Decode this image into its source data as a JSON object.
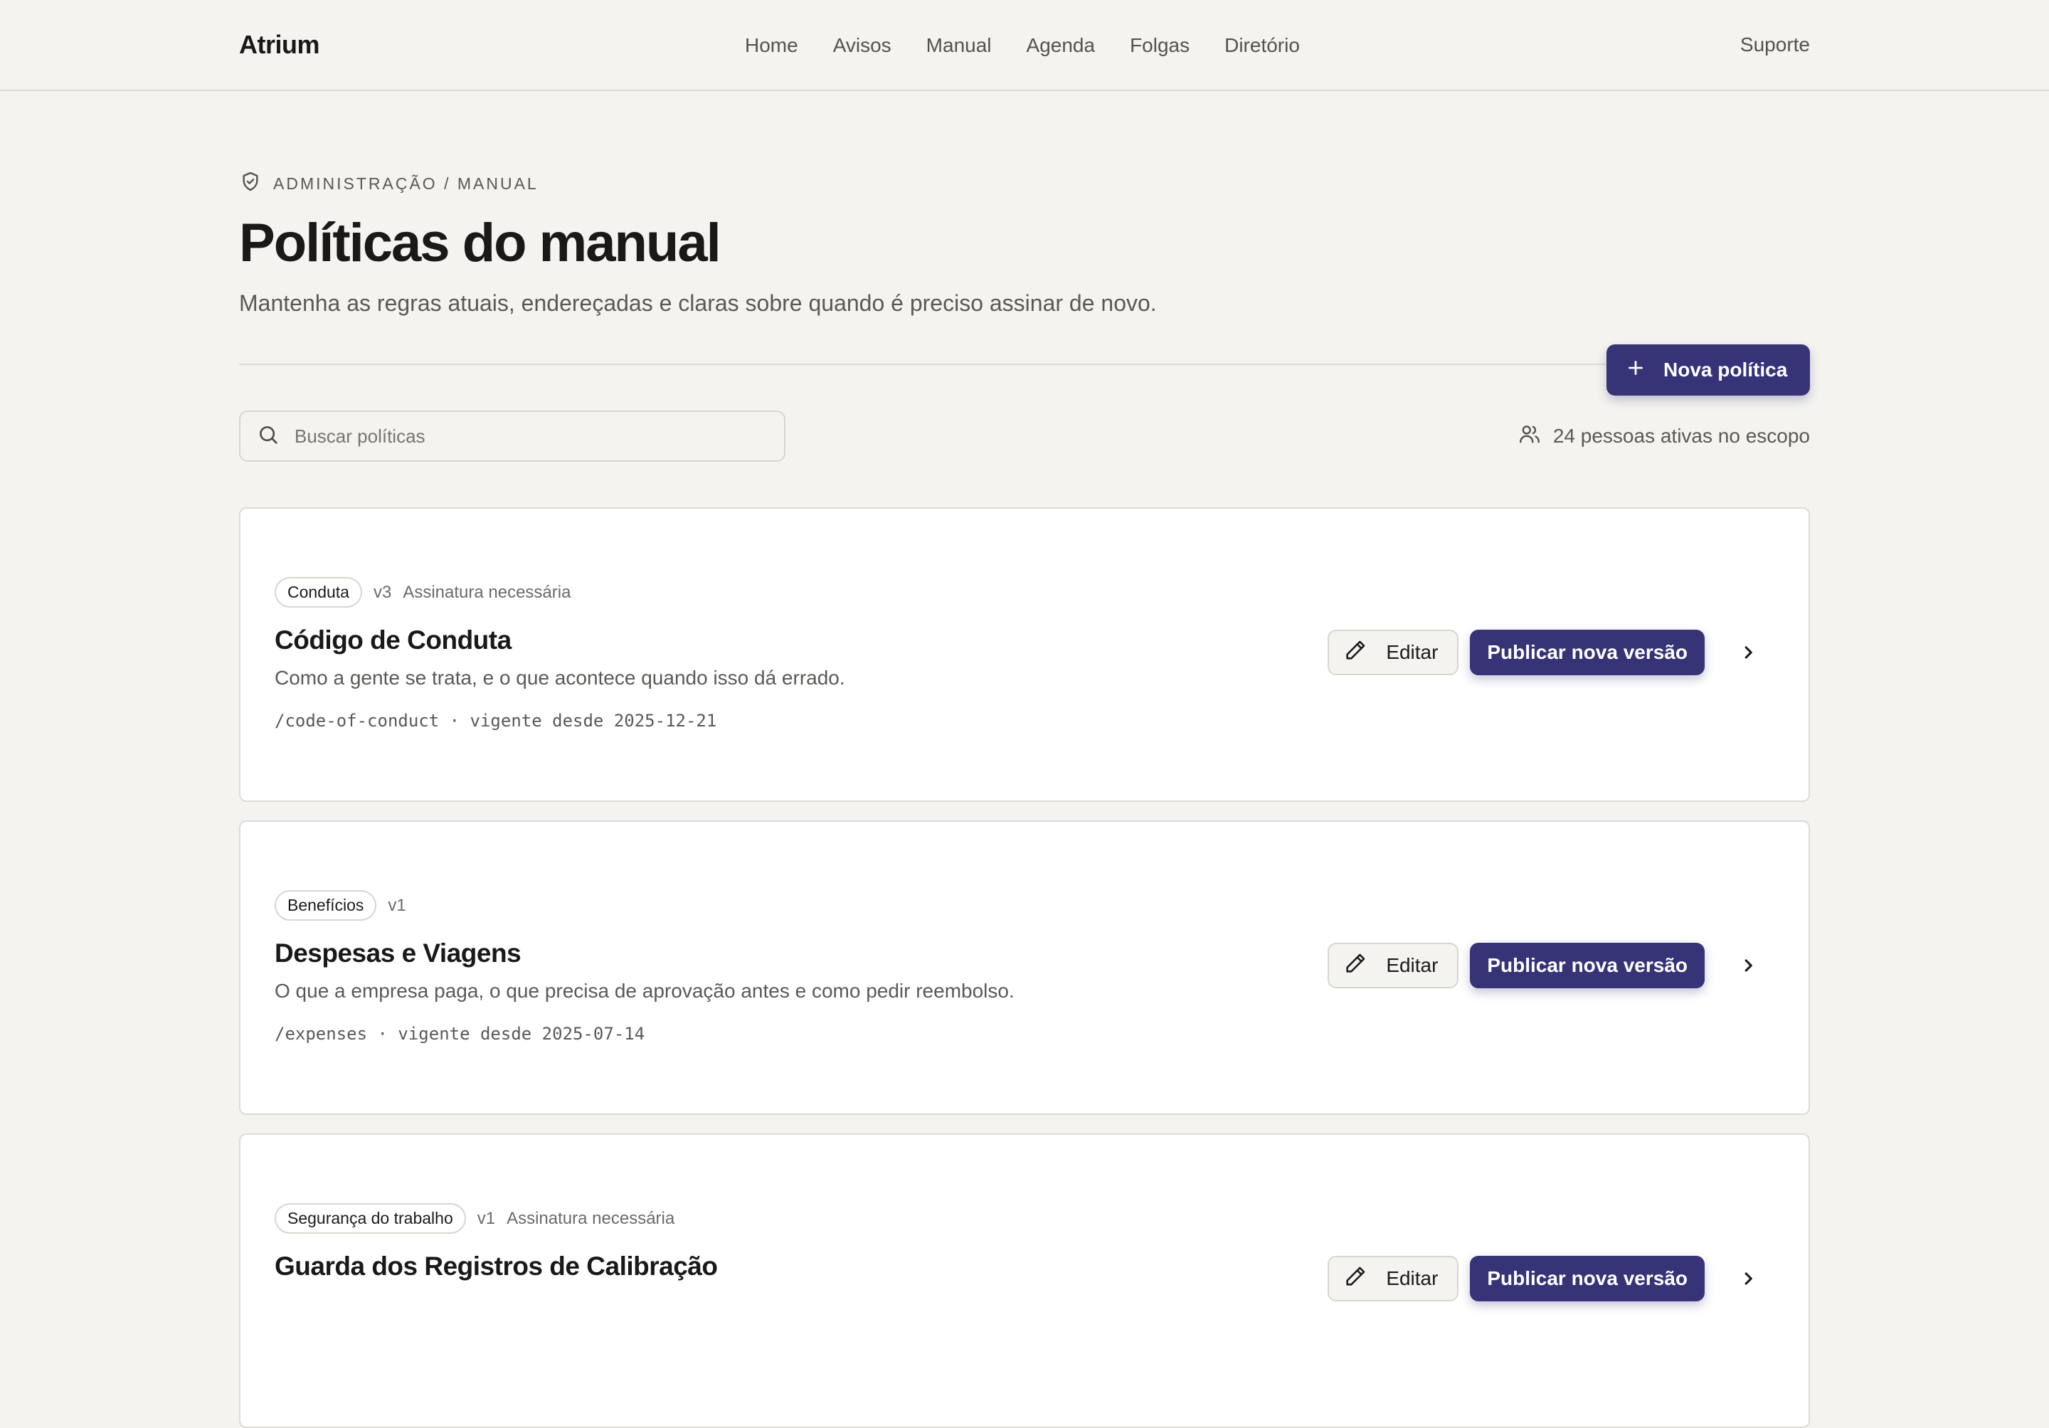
{
  "app": {
    "brand": "Atrium",
    "support": "Suporte"
  },
  "nav": [
    "Home",
    "Avisos",
    "Manual",
    "Agenda",
    "Folgas",
    "Diretório"
  ],
  "page": {
    "breadcrumb": "ADMINISTRAÇÃO / MANUAL",
    "title": "Políticas do manual",
    "subtitle": "Mantenha as regras atuais, endereçadas e claras sobre quando é preciso assinar de novo.",
    "new_button": "Nova política"
  },
  "search": {
    "placeholder": "Buscar políticas",
    "value": ""
  },
  "scope": {
    "label": "24 pessoas ativas no escopo"
  },
  "actions": {
    "edit": "Editar",
    "publish": "Publicar nova versão"
  },
  "policies": [
    {
      "tag": "Conduta",
      "version": "v3",
      "signature": "Assinatura necessária",
      "title": "Código de Conduta",
      "description": "Como a gente se trata, e o que acontece quando isso dá errado.",
      "path": "/code-of-conduct · vigente desde 2025-12-21"
    },
    {
      "tag": "Benefícios",
      "version": "v1",
      "signature": "",
      "title": "Despesas e Viagens",
      "description": "O que a empresa paga, o que precisa de aprovação antes e como pedir reembolso.",
      "path": "/expenses · vigente desde 2025-07-14"
    },
    {
      "tag": "Segurança do trabalho",
      "version": "v1",
      "signature": "Assinatura necessária",
      "title": "Guarda dos Registros de Calibração",
      "description": "",
      "path": ""
    }
  ],
  "colors": {
    "accent": "#363377",
    "background": "#f4f3ef",
    "card": "#ffffff",
    "border": "#dddbd5"
  }
}
